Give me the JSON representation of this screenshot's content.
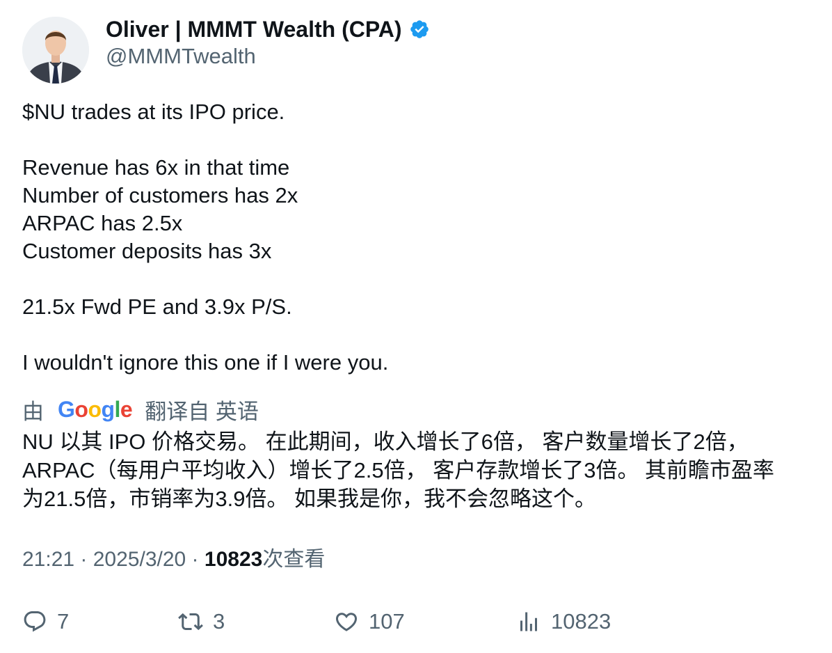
{
  "author": {
    "display_name": "Oliver | MMMT Wealth (CPA)",
    "handle": "@MMMTwealth",
    "verified": true,
    "verified_color": "#1d9bf0"
  },
  "tweet": {
    "lines": [
      "$NU trades at its IPO price.",
      "",
      "Revenue has 6x in that time",
      "Number of customers has 2x",
      "ARPAC has 2.5x",
      "Customer deposits has 3x",
      "",
      "21.5x Fwd PE and 3.9x P/S.",
      "",
      "I wouldn't ignore this one if I were you."
    ]
  },
  "translation": {
    "prefix": "由",
    "provider_letters": [
      "G",
      "o",
      "o",
      "g",
      "l",
      "e"
    ],
    "suffix": "翻译自 英语",
    "lines": [
      "NU 以其 IPO 价格交易。 在此期间，收入增长了6倍， 客户数量增长了2倍，",
      "ARPAC（每用户平均收入）增长了2.5倍， 客户存款增长了3倍。 其前瞻市盈率",
      "为21.5倍，市销率为3.9倍。 如果我是你，我不会忽略这个。"
    ]
  },
  "meta": {
    "time": "21:21",
    "separator": " · ",
    "date": "2025/3/20",
    "views_count": "10823",
    "views_label": "次查看"
  },
  "actions": {
    "replies": "7",
    "retweets": "3",
    "likes": "107",
    "views": "10823"
  },
  "icons": {
    "reply": "reply-icon",
    "retweet": "retweet-icon",
    "like": "heart-icon",
    "views": "analytics-icon",
    "verified": "verified-badge-icon"
  }
}
